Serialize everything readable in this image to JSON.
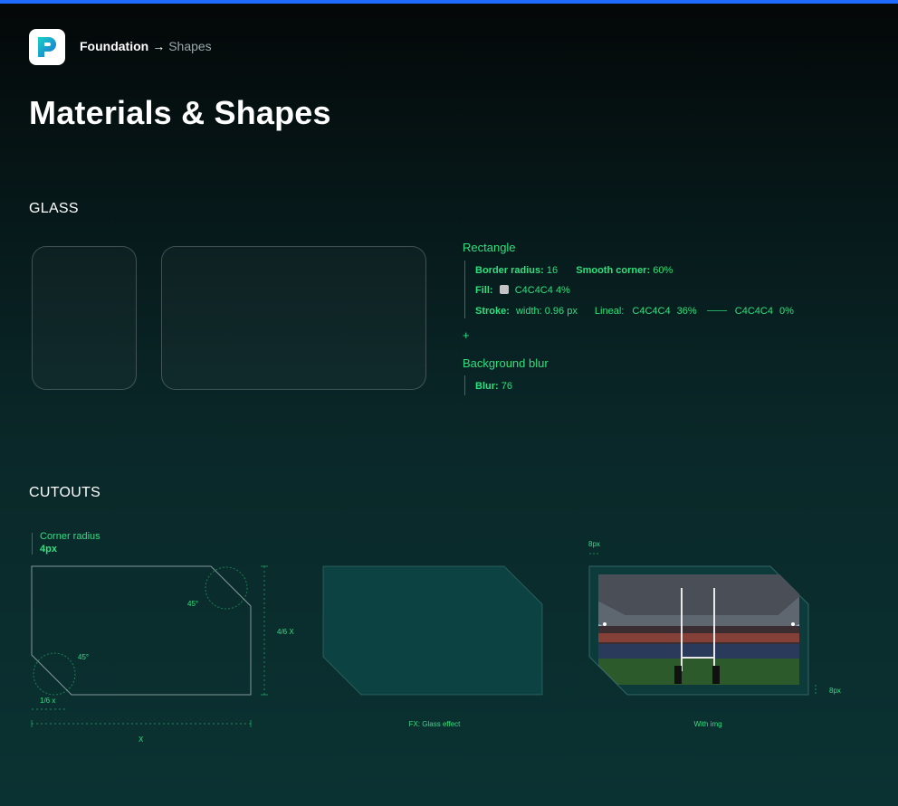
{
  "header": {
    "breadcrumb_parent": "Foundation",
    "breadcrumb_separator": "→",
    "breadcrumb_current": "Shapes"
  },
  "page_title": "Materials & Shapes",
  "glass": {
    "section_title": "GLASS",
    "rectangle": {
      "heading": "Rectangle",
      "border_radius_label": "Border radius:",
      "border_radius_value": "16",
      "smooth_corner_label": "Smooth corner:",
      "smooth_corner_value": "60%",
      "fill_label": "Fill:",
      "fill_color": "C4C4C4",
      "fill_opacity": "4%",
      "stroke_label": "Stroke:",
      "stroke_width": "width: 0.96 px",
      "lineal_label": "Lineal:",
      "lineal_start_color": "C4C4C4",
      "lineal_start_opacity": "36%",
      "lineal_end_color": "C4C4C4",
      "lineal_end_opacity": "0%"
    },
    "plus": "+",
    "background_blur": {
      "heading": "Background blur",
      "blur_label": "Blur:",
      "blur_value": "76"
    }
  },
  "cutouts": {
    "section_title": "CUTOUTS",
    "corner_radius_label": "Corner radius",
    "corner_radius_value": "4px",
    "angle_top": "45°",
    "angle_bottom": "45°",
    "height_label": "4/6 X",
    "cut_label": "1/6 x",
    "width_label": "X",
    "glass_caption": "FX: Glass effect",
    "img_caption": "With img",
    "padding_top_label": "8px",
    "padding_bottom_label": "8px"
  },
  "colors": {
    "accent": "#2fe07e",
    "top_bar": "#1f6bff",
    "fill": "#C4C4C4"
  }
}
